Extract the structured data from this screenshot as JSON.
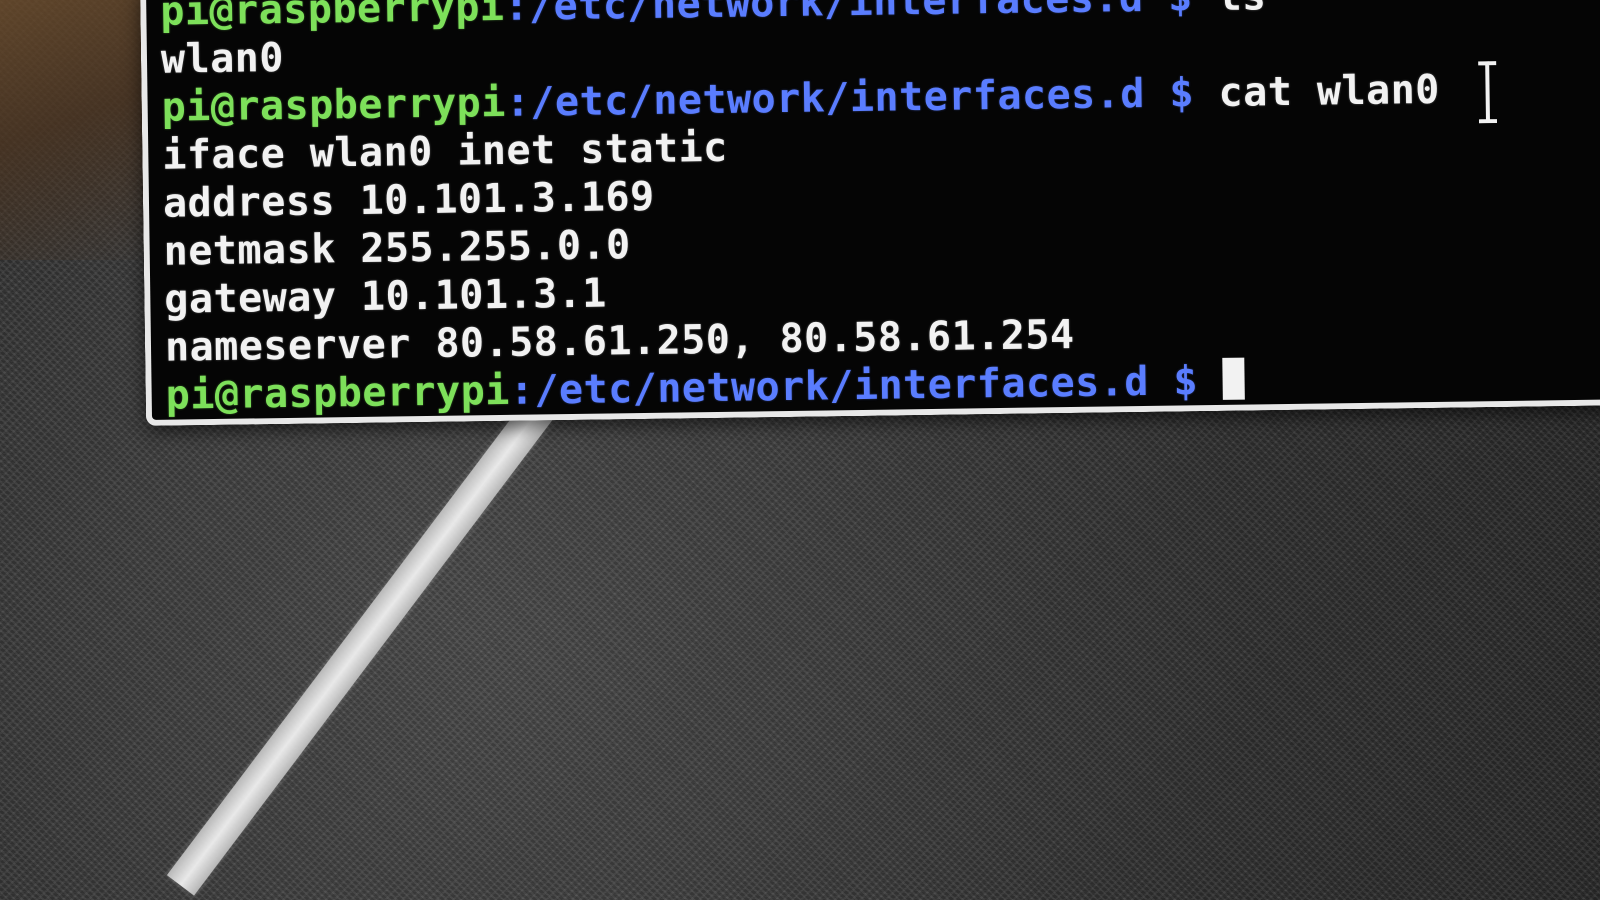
{
  "terminal": {
    "prompt_user_host": "pi@raspberrypi",
    "prompt_path": ":/etc/network/interfaces.d",
    "prompt_symbol": " $ ",
    "lines": [
      {
        "type": "prompt",
        "command": "ls"
      },
      {
        "type": "output",
        "text": "wlan0"
      },
      {
        "type": "prompt",
        "command": "cat wlan0"
      },
      {
        "type": "output",
        "text": "iface wlan0 inet static"
      },
      {
        "type": "output",
        "text": "address 10.101.3.169"
      },
      {
        "type": "output",
        "text": "netmask 255.255.0.0"
      },
      {
        "type": "output",
        "text": "gateway 10.101.3.1"
      },
      {
        "type": "output",
        "text": "nameserver 80.58.61.250, 80.58.61.254"
      },
      {
        "type": "prompt",
        "command": ""
      }
    ]
  },
  "icons": {
    "mouse_cursor": "ibeam-icon",
    "text_cursor": "block-cursor"
  },
  "colors": {
    "terminal_bg": "#050505",
    "user_host": "#7de05a",
    "path": "#5a7dff",
    "text": "#f2f2f2"
  }
}
